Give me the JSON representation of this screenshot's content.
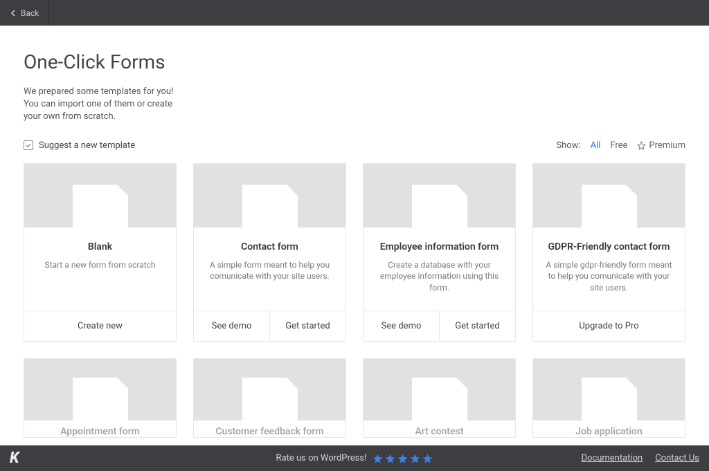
{
  "topbar": {
    "back": "Back"
  },
  "header": {
    "title": "One-Click Forms",
    "subtitle": "We prepared some templates for you! You can import one of them or create your own from scratch."
  },
  "suggest": {
    "label": "Suggest a new template"
  },
  "filters": {
    "label": "Show:",
    "all": "All",
    "free": "Free",
    "premium": "Premium"
  },
  "cards": [
    {
      "title": "Blank",
      "desc": "Start a new form from scratch",
      "actions": [
        "Create new"
      ]
    },
    {
      "title": "Contact form",
      "desc": "A simple form meant to help you comunicate with your site users.",
      "actions": [
        "See demo",
        "Get started"
      ]
    },
    {
      "title": "Employee information form",
      "desc": "Create a database with your employee information using this form.",
      "actions": [
        "See demo",
        "Get started"
      ]
    },
    {
      "title": "GDPR-Friendly contact form",
      "desc": "A simple gdpr-friendly form meant to help you comunicate with your site users.",
      "actions": [
        "Upgrade to Pro"
      ]
    }
  ],
  "partial": [
    {
      "title": "Appointment form"
    },
    {
      "title": "Customer feedback form"
    },
    {
      "title": "Art contest"
    },
    {
      "title": "Job application"
    }
  ],
  "footer": {
    "rate": "Rate us on WordPress!",
    "doc": "Documentation",
    "contact": "Contact Us"
  },
  "colors": {
    "accent": "#2a7de1",
    "star": "#3d7fe0"
  }
}
